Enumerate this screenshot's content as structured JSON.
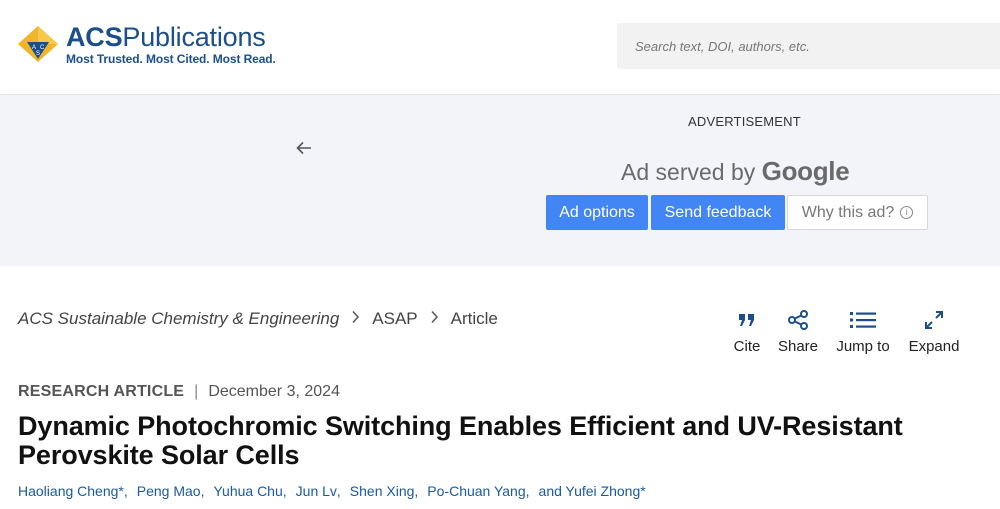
{
  "header": {
    "logo_name_bold": "ACS",
    "logo_name_rest": "Publications",
    "logo_tagline": "Most Trusted. Most Cited. Most Read.",
    "search_placeholder": "Search text, DOI, authors, etc."
  },
  "ad": {
    "label": "ADVERTISEMENT",
    "served_prefix": "Ad served by",
    "served_brand": "Google",
    "options_label": "Ad options",
    "feedback_label": "Send feedback",
    "why_label": "Why this ad?"
  },
  "breadcrumb": {
    "journal": "ACS Sustainable Chemistry & Engineering",
    "section": "ASAP",
    "current": "Article"
  },
  "tools": {
    "cite": "Cite",
    "share": "Share",
    "jump": "Jump to",
    "expand": "Expand"
  },
  "article": {
    "type": "RESEARCH ARTICLE",
    "date": "December 3, 2024",
    "title": "Dynamic Photochromic Switching Enables Efficient and UV-Resistant Perovskite Solar Cells",
    "authors": [
      "Haoliang Cheng*",
      "Peng Mao",
      "Yuhua Chu",
      "Jun Lv",
      "Shen Xing",
      "Po-Chuan Yang",
      "and Yufei Zhong*"
    ]
  },
  "colors": {
    "brand_blue": "#1a4f8b",
    "link_blue": "#1a5aa6",
    "google_blue": "#4285f4",
    "logo_gold": "#f2b52a"
  }
}
